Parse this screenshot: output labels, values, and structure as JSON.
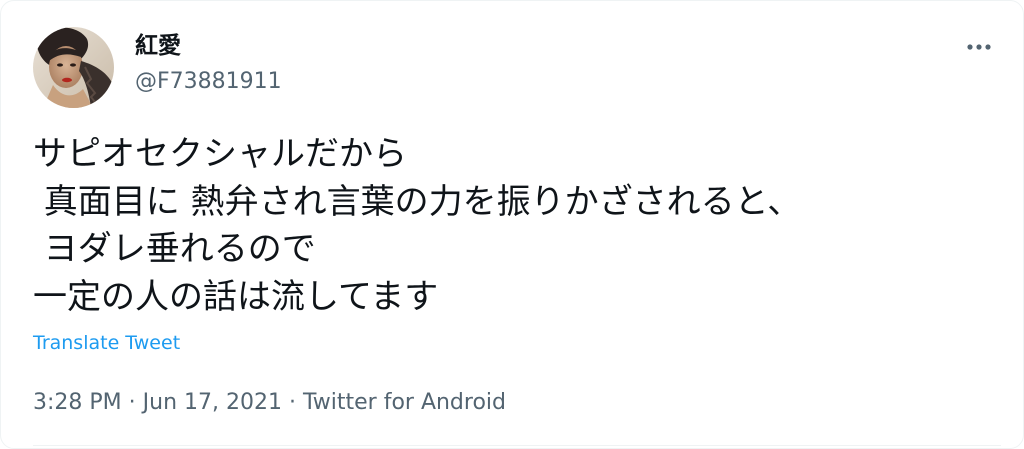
{
  "tweet": {
    "display_name": "紅愛",
    "handle": "@F73881911",
    "text": "サピオセクシャルだから\n 真面目に 熱弁され言葉の力を振りかざされると、\n ヨダレ垂れるので\n一定の人の話は流してます",
    "translate_label": "Translate Tweet",
    "time": "3:28 PM",
    "separator": " · ",
    "date": "Jun 17, 2021",
    "source": "Twitter for Android",
    "more_icon": "more-horizontal-icon"
  },
  "colors": {
    "text": "#0f1419",
    "secondary": "#536471",
    "link": "#1d9bf0",
    "divider": "#eff3f4"
  }
}
